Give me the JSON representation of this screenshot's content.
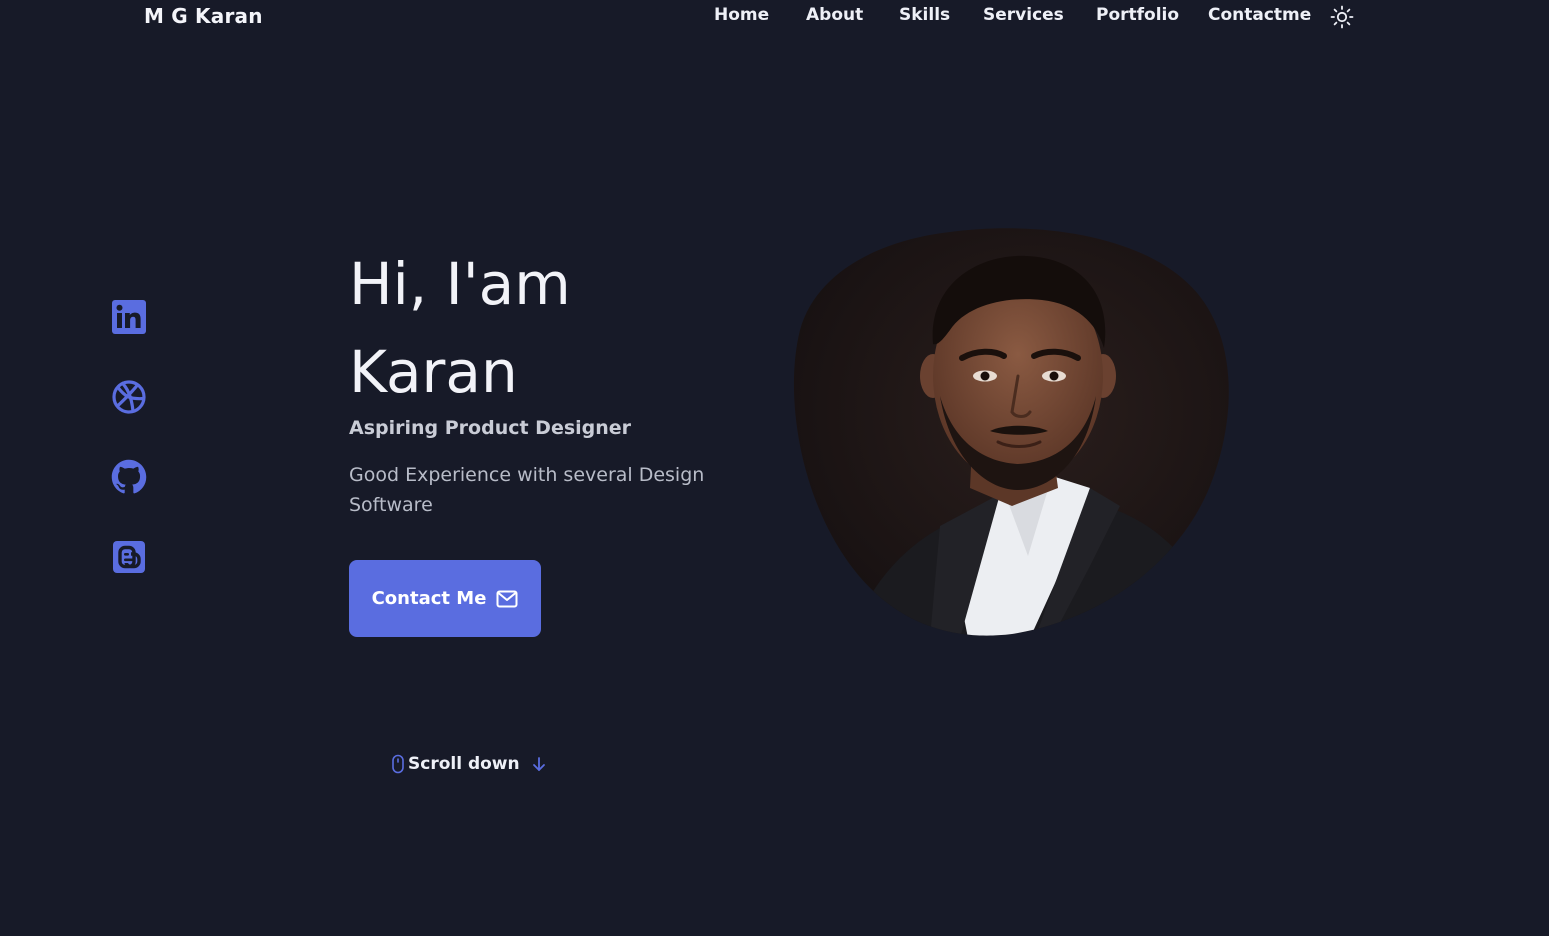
{
  "header": {
    "logo": "M G Karan",
    "nav": [
      {
        "label": "Home"
      },
      {
        "label": "About"
      },
      {
        "label": "Skills"
      },
      {
        "label": "Services"
      },
      {
        "label": "Portfolio"
      },
      {
        "label": "Contactme"
      }
    ],
    "theme_toggle_icon": "sun-icon"
  },
  "social": [
    {
      "name": "linkedin-icon"
    },
    {
      "name": "dribbble-icon"
    },
    {
      "name": "github-icon"
    },
    {
      "name": "blogger-icon"
    }
  ],
  "hero": {
    "greeting": "Hi, I'am",
    "name": "Karan",
    "subtitle": "Aspiring Product Designer",
    "description": "Good Experience with several Design Software",
    "contact_label": "Contact Me",
    "contact_icon": "mail-icon",
    "scroll_label": "Scroll down",
    "scroll_icons": [
      "mouse-icon",
      "arrow-down-icon"
    ]
  },
  "colors": {
    "background": "#171a28",
    "accent": "#5a6de0",
    "text": "#eef0f7",
    "muted_text": "#b8bcc8"
  }
}
